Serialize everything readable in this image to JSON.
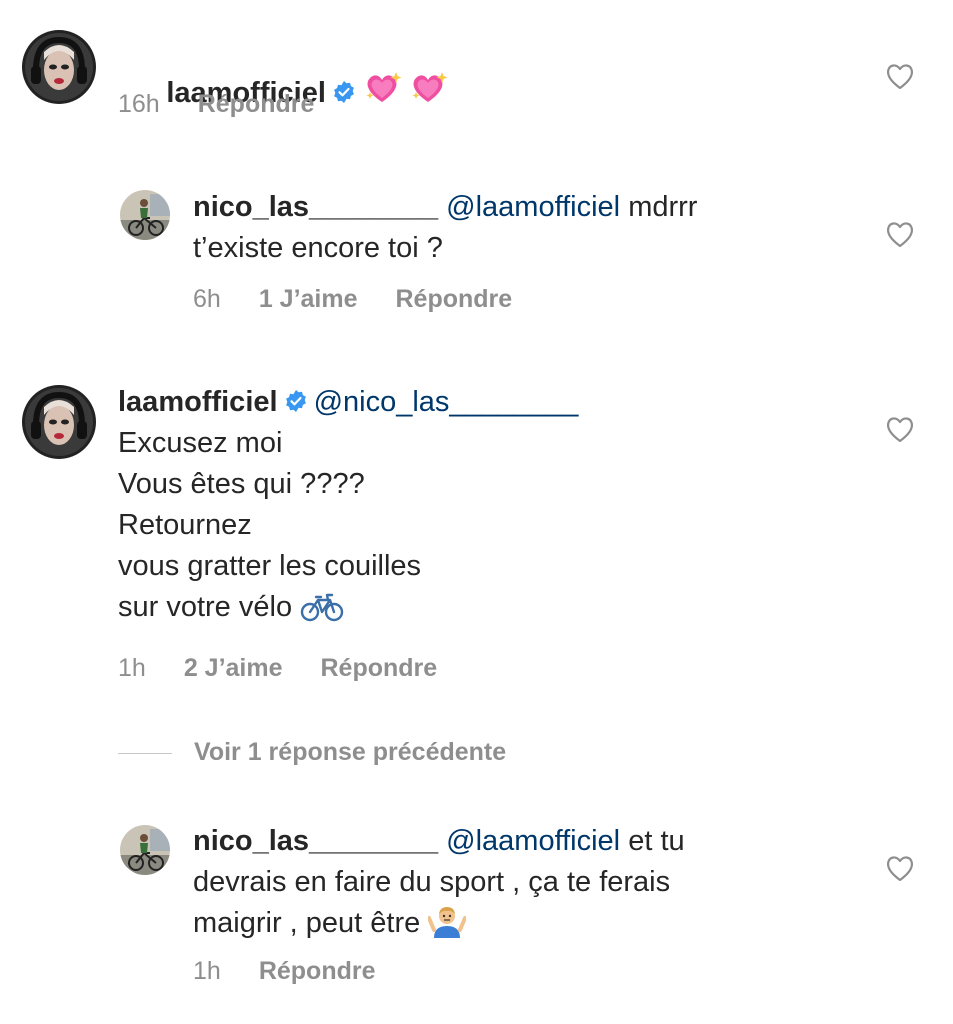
{
  "comments": [
    {
      "username": "laamofficiel",
      "verified": true,
      "lines": [
        ""
      ],
      "emoji": [
        "sparkling-heart-icon",
        "sparkling-heart-icon"
      ],
      "time": "16h",
      "reply_label": "Répondre"
    },
    {
      "username": "nico_las________",
      "mention": "@laamofficiel",
      "lines": [
        "mdrrr",
        "t’existe encore toi ?"
      ],
      "time": "6h",
      "likes": "1 J’aime",
      "reply_label": "Répondre"
    },
    {
      "username": "laamofficiel",
      "verified": true,
      "mention": "@nico_las________",
      "lines": [
        "Excusez moi",
        "Vous êtes qui ????",
        "Retournez",
        "vous gratter les couilles",
        "sur votre vélo"
      ],
      "emoji": [
        "bicycle-icon"
      ],
      "time": "1h",
      "likes": "2 J’aime",
      "reply_label": "Répondre"
    },
    {
      "username": "nico_las________",
      "mention": "@laamofficiel",
      "lines": [
        "et tu",
        "devrais en faire du sport , ça te ferais",
        "maigrir , peut être"
      ],
      "emoji": [
        "person-shrugging-icon"
      ],
      "time": "1h",
      "reply_label": "Répondre"
    }
  ],
  "view_previous": "Voir 1 réponse précédente",
  "colors": {
    "text": "#262626",
    "meta": "#8e8e8e",
    "mention": "#00376b",
    "verified": "#3897f0"
  }
}
